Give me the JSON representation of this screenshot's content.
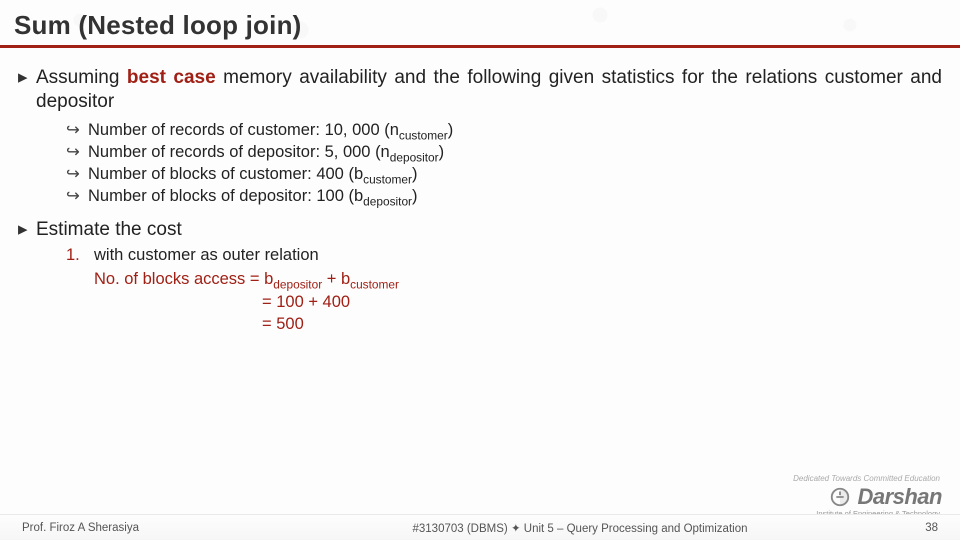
{
  "title": "Sum (Nested loop join)",
  "bullets": {
    "l1a_pre": "Assuming ",
    "l1a_accent": "best case",
    "l1a_post": " memory availability and the following given statistics for the relations customer and depositor",
    "sub": {
      "a_pre": "Number of records of customer: 10, 000 (n",
      "a_sub": "customer",
      "a_post": ")",
      "b_pre": "Number of records of depositor: 5, 000 (n",
      "b_sub": "depositor",
      "b_post": ")",
      "c_pre": "Number of blocks of customer: 400 (b",
      "c_sub": "customer",
      "c_post": ")",
      "d_pre": "Number of blocks of depositor: 100 (b",
      "d_sub": "depositor",
      "d_post": ")"
    },
    "l1b": "Estimate the cost",
    "ol1": {
      "num": "1.",
      "line1": "with customer as outer relation",
      "line2_pre": "No. of blocks access = b",
      "line2_sub1": "depositor",
      "line2_mid": " + b",
      "line2_sub2": "customer",
      "eq1": "= 100 + 400",
      "eq2": "= 500"
    }
  },
  "footer": {
    "prof": "Prof. Firoz A Sherasiya",
    "course": "#3130703 (DBMS) ",
    "diamond": "✦",
    "unit": "  Unit 5 – Query Processing and Optimization",
    "page": "38"
  },
  "logo": {
    "name": "Darshan",
    "tagline": "Dedicated Towards Committed Education",
    "subtitle": "Institute of Engineering & Technology"
  },
  "markers": {
    "tri": "▸",
    "arrow": "↪"
  }
}
